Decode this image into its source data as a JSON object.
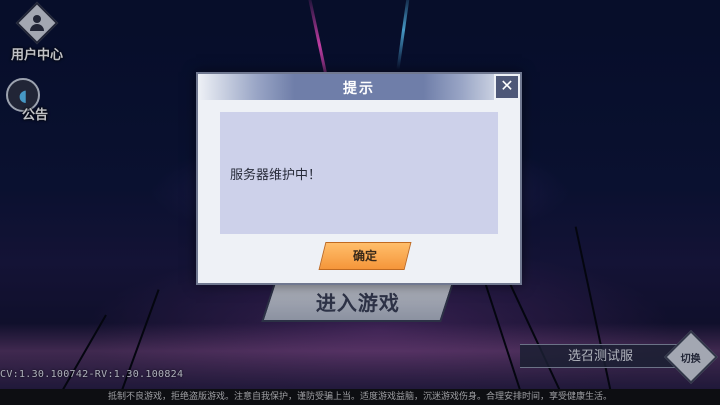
{
  "hud": {
    "user_center_label": "用户中心",
    "notice_label": "公告",
    "enter_game_label": "进入游戏",
    "version_text": "CV:1.30.100742-RV:1.30.100824"
  },
  "server_select": {
    "label": "选召测试服",
    "switch_label": "切换"
  },
  "footer": {
    "text": "抵制不良游戏，拒绝盗版游戏。注意自我保护，谨防受骗上当。适度游戏益脑，沉迷游戏伤身。合理安排时间，享受健康生活。"
  },
  "dialog": {
    "title": "提示",
    "message": "服务器维护中！",
    "confirm_label": "确定",
    "close_symbol": "✕"
  },
  "colors": {
    "dialog_header": "#6f7ea9",
    "dialog_body": "#cdd1ea",
    "confirm_button": "#f5963a"
  }
}
